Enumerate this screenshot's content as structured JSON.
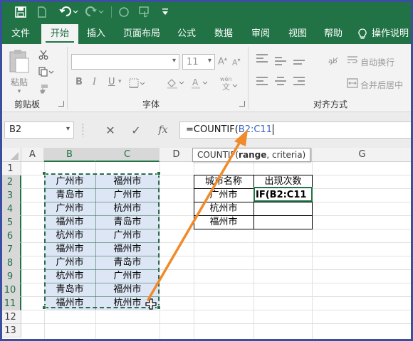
{
  "qat": {
    "items": [
      {
        "name": "save-icon",
        "glyph": "💾"
      },
      {
        "name": "new-file-icon",
        "glyph": "▯"
      },
      {
        "name": "undo-icon",
        "glyph": "↶"
      },
      {
        "name": "redo-icon",
        "glyph": "↷"
      },
      {
        "name": "circle-icon",
        "glyph": "○"
      },
      {
        "name": "touch-mode-icon",
        "glyph": "☞"
      },
      {
        "name": "customize-qat-icon",
        "glyph": "⇟"
      }
    ]
  },
  "tabs": [
    "文件",
    "开始",
    "插入",
    "页面布局",
    "公式",
    "数据",
    "审阅",
    "视图",
    "帮助"
  ],
  "active_tab": "开始",
  "tell_me": {
    "icon": "lightbulb-icon",
    "label": "操作说明"
  },
  "ribbon": {
    "clipboard": {
      "paste_label": "粘贴",
      "group_label": "剪贴板"
    },
    "font": {
      "size": "11",
      "bold": "B",
      "italic": "I",
      "underline": "U",
      "group_label": "字体"
    },
    "alignment": {
      "wrap_label": "自动换行",
      "merge_label": "合并后居中",
      "group_label": "对齐方式"
    }
  },
  "formula_bar": {
    "name_box": "B2",
    "cancel": "✕",
    "enter": "✓",
    "fx": "fx",
    "formula_prefix": "=COUNTIF(",
    "formula_ref": "B2:C11"
  },
  "tooltip": {
    "func": "COUNTIF(",
    "arg1": "range",
    "rest": ", criteria)"
  },
  "columns": [
    "A",
    "B",
    "C",
    "D",
    "E",
    "F",
    "G"
  ],
  "rows": [
    "1",
    "2",
    "3",
    "4",
    "5",
    "6",
    "7",
    "8",
    "9",
    "10",
    "11",
    "12",
    "13"
  ],
  "source_table": [
    [
      "广州市",
      "福州市"
    ],
    [
      "青岛市",
      "广州市"
    ],
    [
      "广州市",
      "杭州市"
    ],
    [
      "福州市",
      "青岛市"
    ],
    [
      "杭州市",
      "广州市"
    ],
    [
      "福州市",
      "福州市"
    ],
    [
      "广州市",
      "青岛市"
    ],
    [
      "杭州市",
      "广州市"
    ],
    [
      "青岛市",
      "福州市"
    ],
    [
      "福州市",
      "杭州市"
    ]
  ],
  "summary_table": {
    "headers": [
      "城市名称",
      "出现次数"
    ],
    "rows": [
      [
        "广州市",
        "IF(B2:C11"
      ],
      [
        "杭州市",
        ""
      ],
      [
        "福州市",
        ""
      ]
    ]
  },
  "colors": {
    "brand": "#217346",
    "selection_fill": "#dde6f5",
    "arrow": "#f08a2a",
    "frame": "#3b4fa1"
  }
}
